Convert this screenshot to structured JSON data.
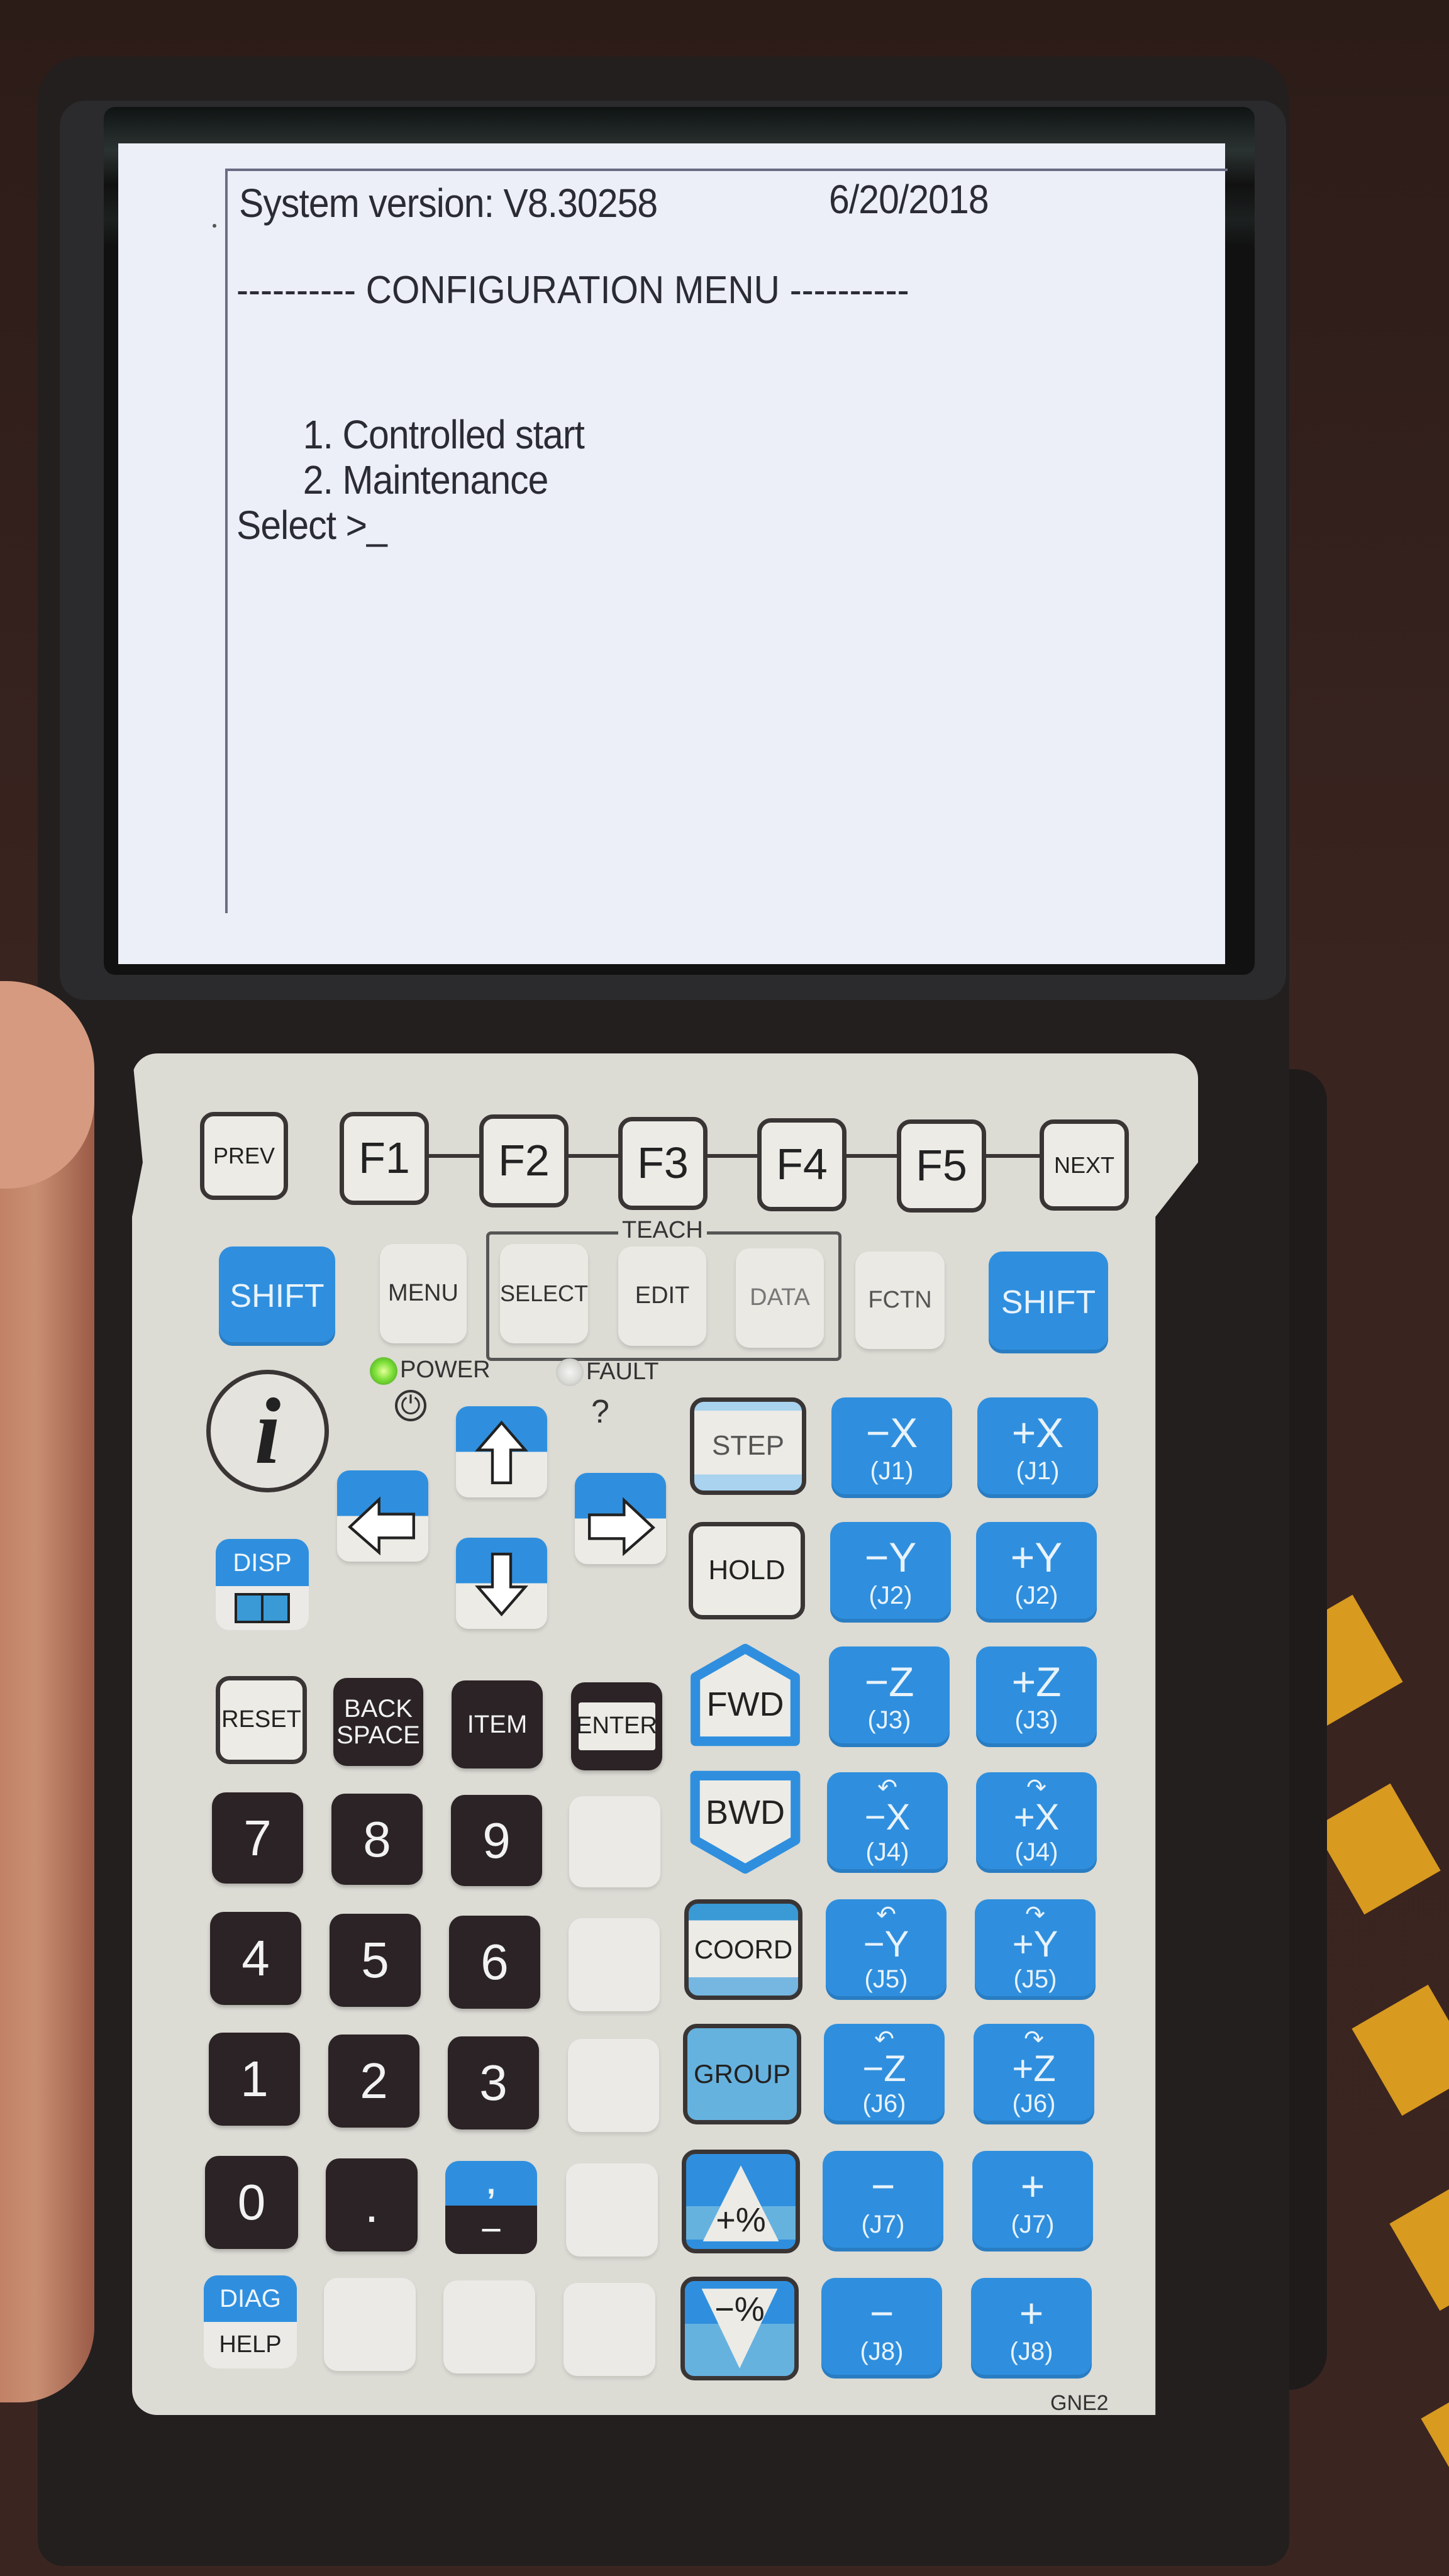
{
  "device": {
    "model_label": "GNE2",
    "colors": {
      "key_blue": "#2f8fde",
      "keyplate": "#dcdbd4",
      "key_dark": "#2b2325",
      "lcd_background": "#eceef8",
      "power_led_on": "#7fe03a",
      "fault_led_off": "#d9d9d6"
    }
  },
  "screen": {
    "system_version_label": "System version: V8.30258",
    "date": "6/20/2018",
    "menu_title_line": "---------- CONFIGURATION MENU ----------",
    "menu_items": [
      {
        "number": "1.",
        "label": "Controlled start"
      },
      {
        "number": "2.",
        "label": "Maintenance"
      }
    ],
    "prompt": "Select >_"
  },
  "function_row": {
    "prev": "PREV",
    "f_keys": [
      "F1",
      "F2",
      "F3",
      "F4",
      "F5"
    ],
    "next": "NEXT"
  },
  "menu_row": {
    "shift_left": "SHIFT",
    "menu": "MENU",
    "teach_group_label": "TEACH",
    "select": "SELECT",
    "edit": "EDIT",
    "data": "DATA",
    "fctn": "FCTN",
    "shift_right": "SHIFT"
  },
  "indicators": {
    "power_label": "POWER",
    "power_state": "on",
    "fault_label": "FAULT",
    "fault_state": "off",
    "fault_symbol": "?",
    "info_key": "i"
  },
  "nav_keys": {
    "disp": "DISP",
    "up": "up",
    "down": "down",
    "left": "left",
    "right": "right"
  },
  "control_keys": {
    "step": "STEP",
    "hold": "HOLD",
    "fwd": "FWD",
    "bwd": "BWD",
    "coord": "COORD",
    "group": "GROUP",
    "speed_up": "+%",
    "speed_down": "−%"
  },
  "edit_keys": {
    "reset": "RESET",
    "backspace_line1": "BACK",
    "backspace_line2": "SPACE",
    "item": "ITEM",
    "enter": "ENTER"
  },
  "numpad": {
    "rows": [
      [
        "7",
        "8",
        "9"
      ],
      [
        "4",
        "5",
        "6"
      ],
      [
        "1",
        "2",
        "3"
      ],
      [
        "0",
        "."
      ]
    ],
    "comma_minus_top": ",",
    "comma_minus_bottom": "−",
    "diag": "DIAG",
    "help": "HELP"
  },
  "jog_keys": [
    {
      "minus": "−X",
      "plus": "+X",
      "joint": "(J1)",
      "rotation": false
    },
    {
      "minus": "−Y",
      "plus": "+Y",
      "joint": "(J2)",
      "rotation": false
    },
    {
      "minus": "−Z",
      "plus": "+Z",
      "joint": "(J3)",
      "rotation": false
    },
    {
      "minus": "−X",
      "plus": "+X",
      "joint": "(J4)",
      "rotation": true
    },
    {
      "minus": "−Y",
      "plus": "+Y",
      "joint": "(J5)",
      "rotation": true
    },
    {
      "minus": "−Z",
      "plus": "+Z",
      "joint": "(J6)",
      "rotation": true
    },
    {
      "minus": "−",
      "plus": "+",
      "joint": "(J7)",
      "rotation": false
    },
    {
      "minus": "−",
      "plus": "+",
      "joint": "(J8)",
      "rotation": false
    }
  ]
}
